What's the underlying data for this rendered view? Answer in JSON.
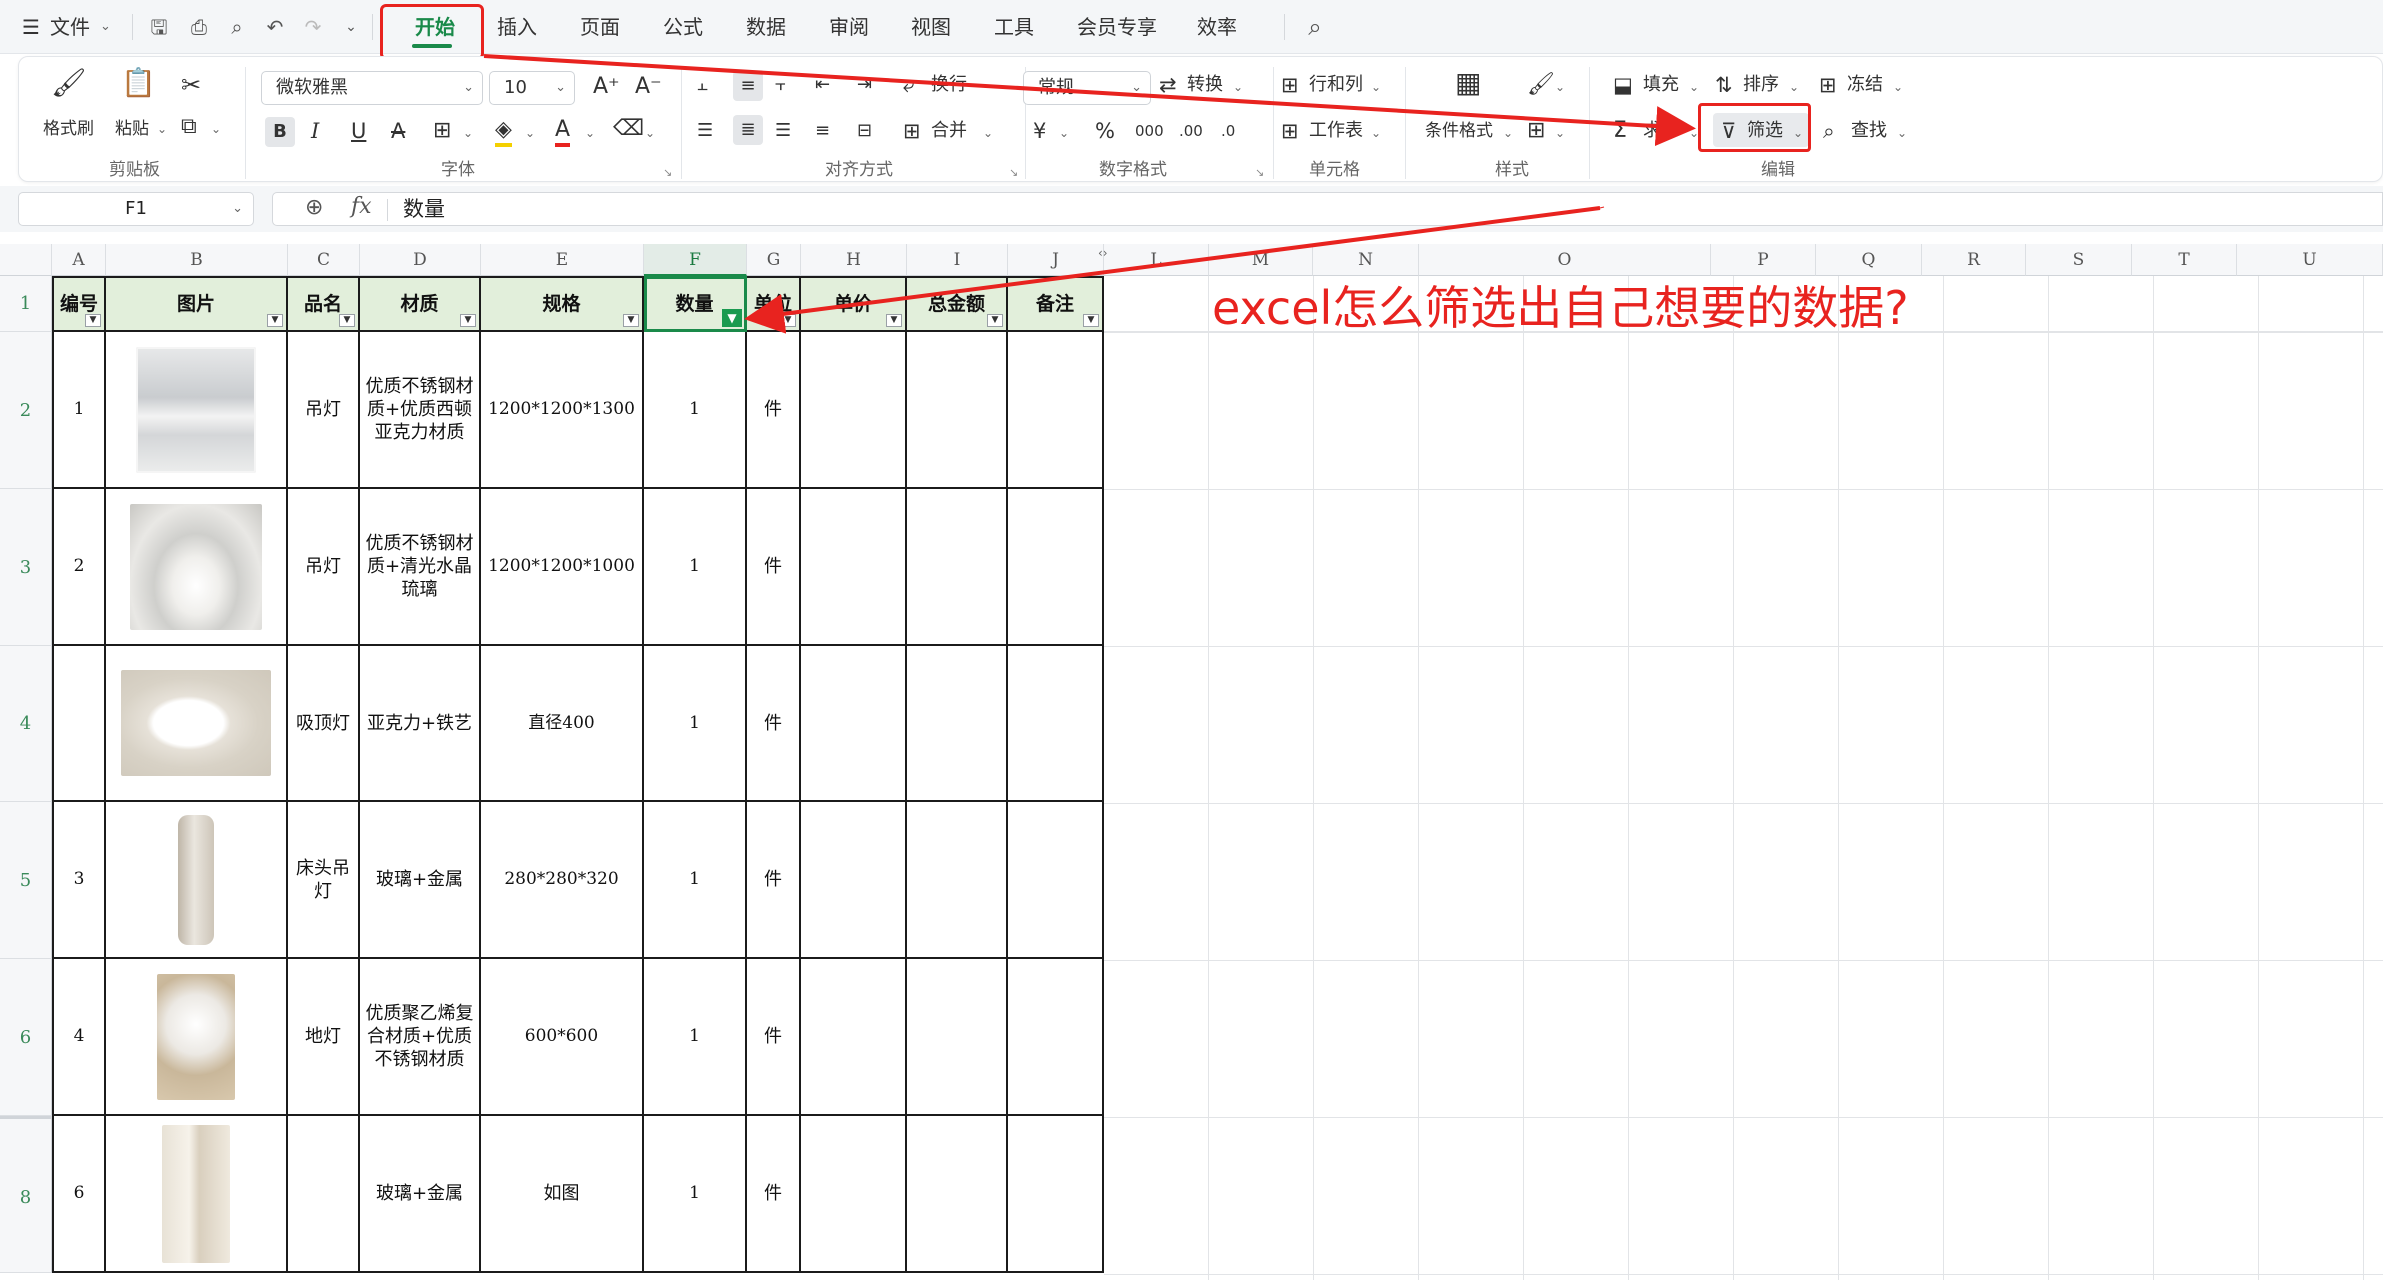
{
  "menubar": {
    "file_label": "文件",
    "tabs": [
      "开始",
      "插入",
      "页面",
      "公式",
      "数据",
      "审阅",
      "视图",
      "工具",
      "会员专享",
      "效率"
    ],
    "active_tab": "开始"
  },
  "ribbon": {
    "clipboard": {
      "format_painter": "格式刷",
      "paste": "粘贴",
      "group": "剪贴板"
    },
    "font": {
      "name": "微软雅黑",
      "size": "10",
      "group": "字体"
    },
    "align": {
      "wrap": "换行",
      "merge": "合并",
      "group": "对齐方式"
    },
    "number": {
      "format": "常规",
      "convert": "转换",
      "group": "数字格式"
    },
    "cells": {
      "row_col": "行和列",
      "sheet": "工作表",
      "group": "单元格"
    },
    "styles": {
      "cond_format": "条件格式",
      "group": "样式"
    },
    "edit": {
      "fill": "填充",
      "sort": "排序",
      "freeze": "冻结",
      "sum": "求和",
      "filter": "筛选",
      "find": "查找",
      "group": "编辑"
    }
  },
  "formula_bar": {
    "cell_ref": "F1",
    "fx": "fx",
    "value": "数量"
  },
  "columns": [
    "A",
    "B",
    "C",
    "D",
    "E",
    "F",
    "G",
    "H",
    "I",
    "J",
    "L",
    "M",
    "N",
    "O",
    "P",
    "Q",
    "R",
    "S",
    "T",
    "U"
  ],
  "headers": [
    "编号",
    "图片",
    "品名",
    "材质",
    "规格",
    "数量",
    "单位",
    "单价",
    "总金额",
    "备注"
  ],
  "rows": [
    {
      "row": "2",
      "no": "1",
      "name": "吊灯",
      "material": "优质不锈钢材质+优质西顿亚克力材质",
      "spec": "1200*1200*1300",
      "qty": "1",
      "unit": "件"
    },
    {
      "row": "3",
      "no": "2",
      "name": "吊灯",
      "material": "优质不锈钢材质+清光水晶琉璃",
      "spec": "1200*1200*1000",
      "qty": "1",
      "unit": "件"
    },
    {
      "row": "4",
      "no": "",
      "name": "吸顶灯",
      "material": "亚克力+铁艺",
      "spec": "直径400",
      "qty": "1",
      "unit": "件"
    },
    {
      "row": "5",
      "no": "3",
      "name": "床头吊灯",
      "material": "玻璃+金属",
      "spec": "280*280*320",
      "qty": "1",
      "unit": "件"
    },
    {
      "row": "6",
      "no": "4",
      "name": "地灯",
      "material": "优质聚乙烯复合材质+优质不锈钢材质",
      "spec": "600*600",
      "qty": "1",
      "unit": "件"
    },
    {
      "row": "8",
      "no": "6",
      "name": "",
      "material": "玻璃+金属",
      "spec": "如图",
      "qty": "1",
      "unit": "件"
    }
  ],
  "header_row_number": "1",
  "annotation": "excel怎么筛选出自己想要的数据?",
  "colors": {
    "accent": "#1a8a4a",
    "highlight": "#e8231f",
    "header_fill": "#e2efdb"
  }
}
